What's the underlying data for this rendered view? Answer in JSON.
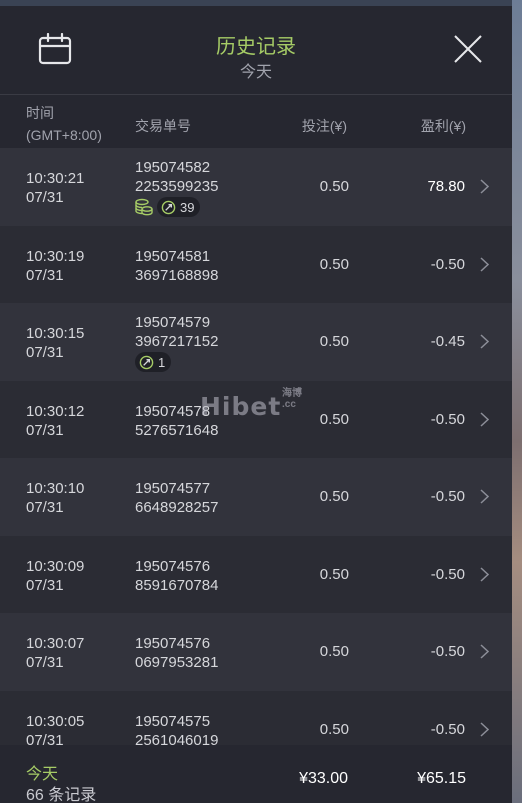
{
  "header": {
    "title": "历史记录",
    "subtitle": "今天"
  },
  "columns": {
    "time_line1": "时间",
    "time_line2": "(GMT+8:00)",
    "order": "交易单号",
    "bet": "投注(¥)",
    "profit": "盈利(¥)"
  },
  "rows": [
    {
      "time": "10:30:21",
      "date": "07/31",
      "order1": "195074582",
      "order2": "2253599235",
      "bet": "0.50",
      "profit": "78.80",
      "badge_count": "39",
      "win": true
    },
    {
      "time": "10:30:19",
      "date": "07/31",
      "order1": "195074581",
      "order2": "3697168898",
      "bet": "0.50",
      "profit": "-0.50"
    },
    {
      "time": "10:30:15",
      "date": "07/31",
      "order1": "195074579",
      "order2": "3967217152",
      "bet": "0.50",
      "profit": "-0.45",
      "badge_count": "1"
    },
    {
      "time": "10:30:12",
      "date": "07/31",
      "order1": "195074578",
      "order2": "5276571648",
      "bet": "0.50",
      "profit": "-0.50"
    },
    {
      "time": "10:30:10",
      "date": "07/31",
      "order1": "195074577",
      "order2": "6648928257",
      "bet": "0.50",
      "profit": "-0.50"
    },
    {
      "time": "10:30:09",
      "date": "07/31",
      "order1": "195074576",
      "order2": "8591670784",
      "bet": "0.50",
      "profit": "-0.50"
    },
    {
      "time": "10:30:07",
      "date": "07/31",
      "order1": "195074576",
      "order2": "0697953281",
      "bet": "0.50",
      "profit": "-0.50"
    },
    {
      "time": "10:30:05",
      "date": "07/31",
      "order1": "195074575",
      "order2": "2561046019",
      "bet": "0.50",
      "profit": "-0.50"
    }
  ],
  "footer": {
    "label": "今天",
    "count": "66 条记录",
    "total_bet": "¥33.00",
    "total_profit": "¥65.15"
  },
  "watermark": {
    "text": "Hibet",
    "sub1": "海博",
    "sub2": ".cc"
  },
  "icons": {
    "calendar": "calendar-icon",
    "close": "close-icon",
    "coin": "coin-stack-icon",
    "badge": "free-spin-icon",
    "row": "chevron-right-icon"
  },
  "colors": {
    "accent": "#a6cc66",
    "panel": "#2b2c34",
    "header": "#262730",
    "text": "#d6d7db",
    "muted": "#a1a3ad"
  }
}
